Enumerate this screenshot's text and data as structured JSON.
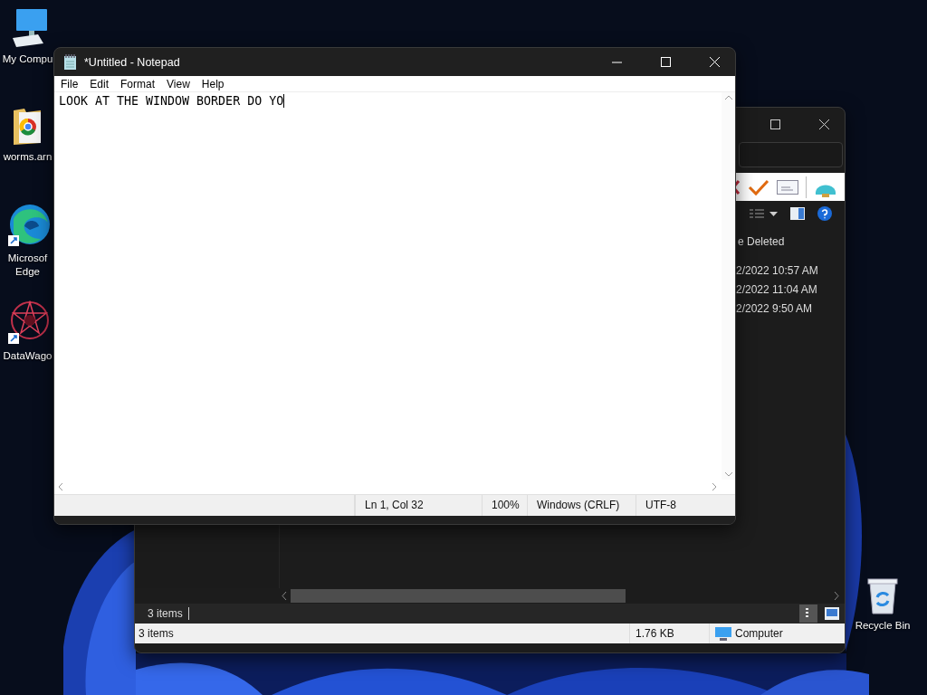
{
  "desktop_icons": [
    {
      "label": "My Compu",
      "kind": "computer"
    },
    {
      "label": "worms.arn",
      "kind": "folder"
    },
    {
      "label": "Microsof\nEdge",
      "kind": "edge"
    },
    {
      "label": "DataWago",
      "kind": "datawagon"
    }
  ],
  "recycle_bin": {
    "label": "Recycle Bin"
  },
  "notepad": {
    "title": "*Untitled - Notepad",
    "menu": [
      "File",
      "Edit",
      "Format",
      "View",
      "Help"
    ],
    "text": "LOOK AT THE WINDOW BORDER DO YO",
    "status_bar": [
      "Ln 1, Col 32",
      "100%",
      "Windows (CRLF)",
      "UTF-8"
    ]
  },
  "explorer": {
    "column_header": "e Deleted",
    "rows": [
      "2/2022 10:57 AM",
      "2/2022 11:04 AM",
      "2/2022 9:50 AM"
    ],
    "status_bar": {
      "count": "3 items"
    },
    "details_bar": {
      "count": "3 items",
      "size": "1.76 KB",
      "location": "Computer"
    }
  }
}
